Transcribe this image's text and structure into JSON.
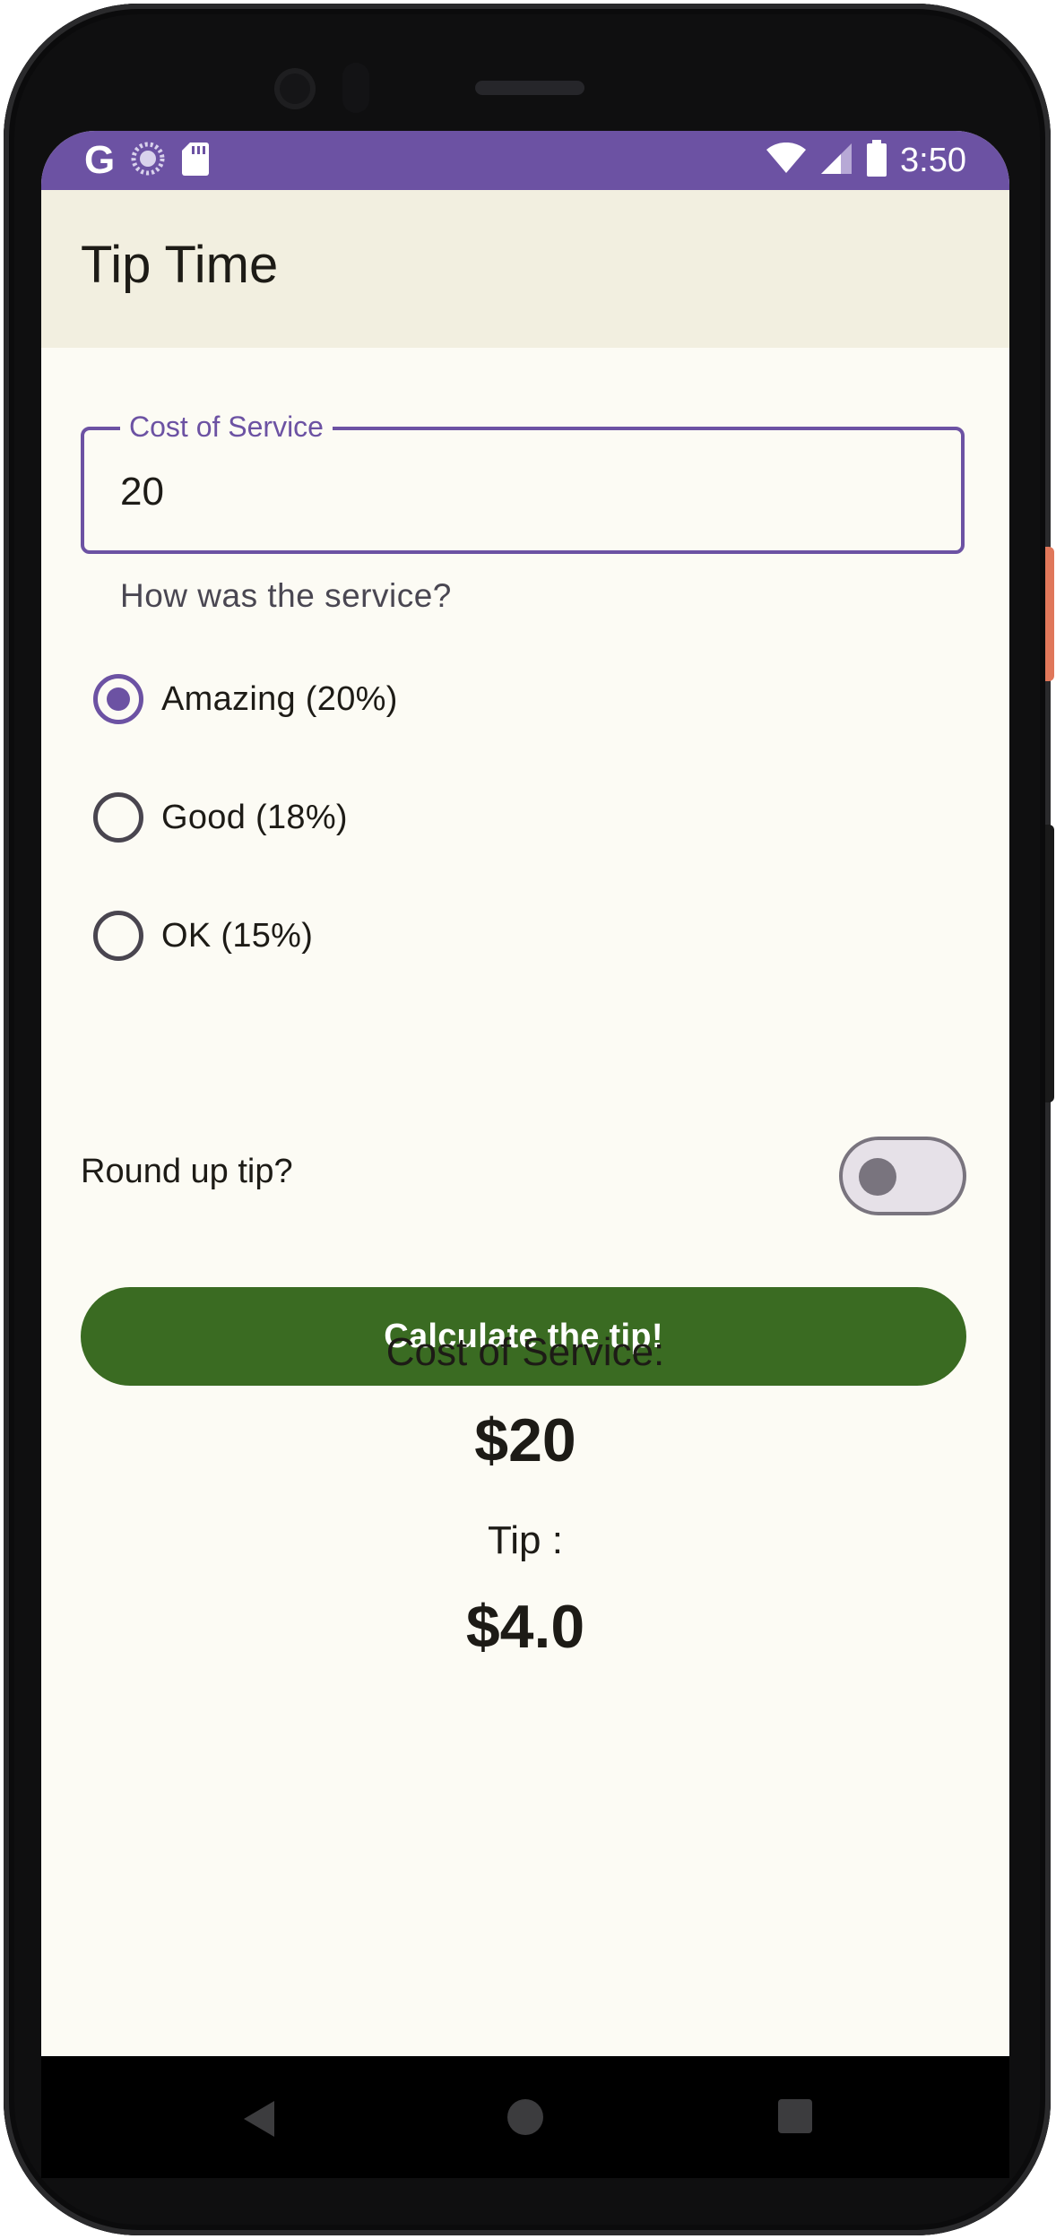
{
  "status_bar": {
    "time": "3:50",
    "left_icons": [
      "google-icon",
      "loading-icon",
      "sd-card-icon"
    ],
    "right_icons": [
      "wifi-icon",
      "cell-signal-icon",
      "battery-icon"
    ],
    "google_glyph": "G"
  },
  "app_bar": {
    "title": "Tip Time"
  },
  "cost_field": {
    "label": "Cost of Service",
    "value": "20"
  },
  "service_question": "How was the service?",
  "tip_options": [
    {
      "label": "Amazing (20%)",
      "selected": true
    },
    {
      "label": "Good (18%)",
      "selected": false
    },
    {
      "label": "OK (15%)",
      "selected": false
    }
  ],
  "round_up": {
    "label": "Round up tip?",
    "on": false
  },
  "calculate_button": {
    "label": "Calculate the tip!"
  },
  "results": {
    "cost_label": "Cost of Service:",
    "cost_value": "$20",
    "tip_label": "Tip :",
    "tip_value": "$4.0"
  },
  "colors": {
    "primary": "#6c52a3",
    "button_green": "#3a6b22",
    "background": "#fcfbf4",
    "app_bar": "#f2efe0"
  },
  "nav_bar": {
    "icons": [
      "back-icon",
      "home-icon",
      "recents-icon"
    ]
  }
}
